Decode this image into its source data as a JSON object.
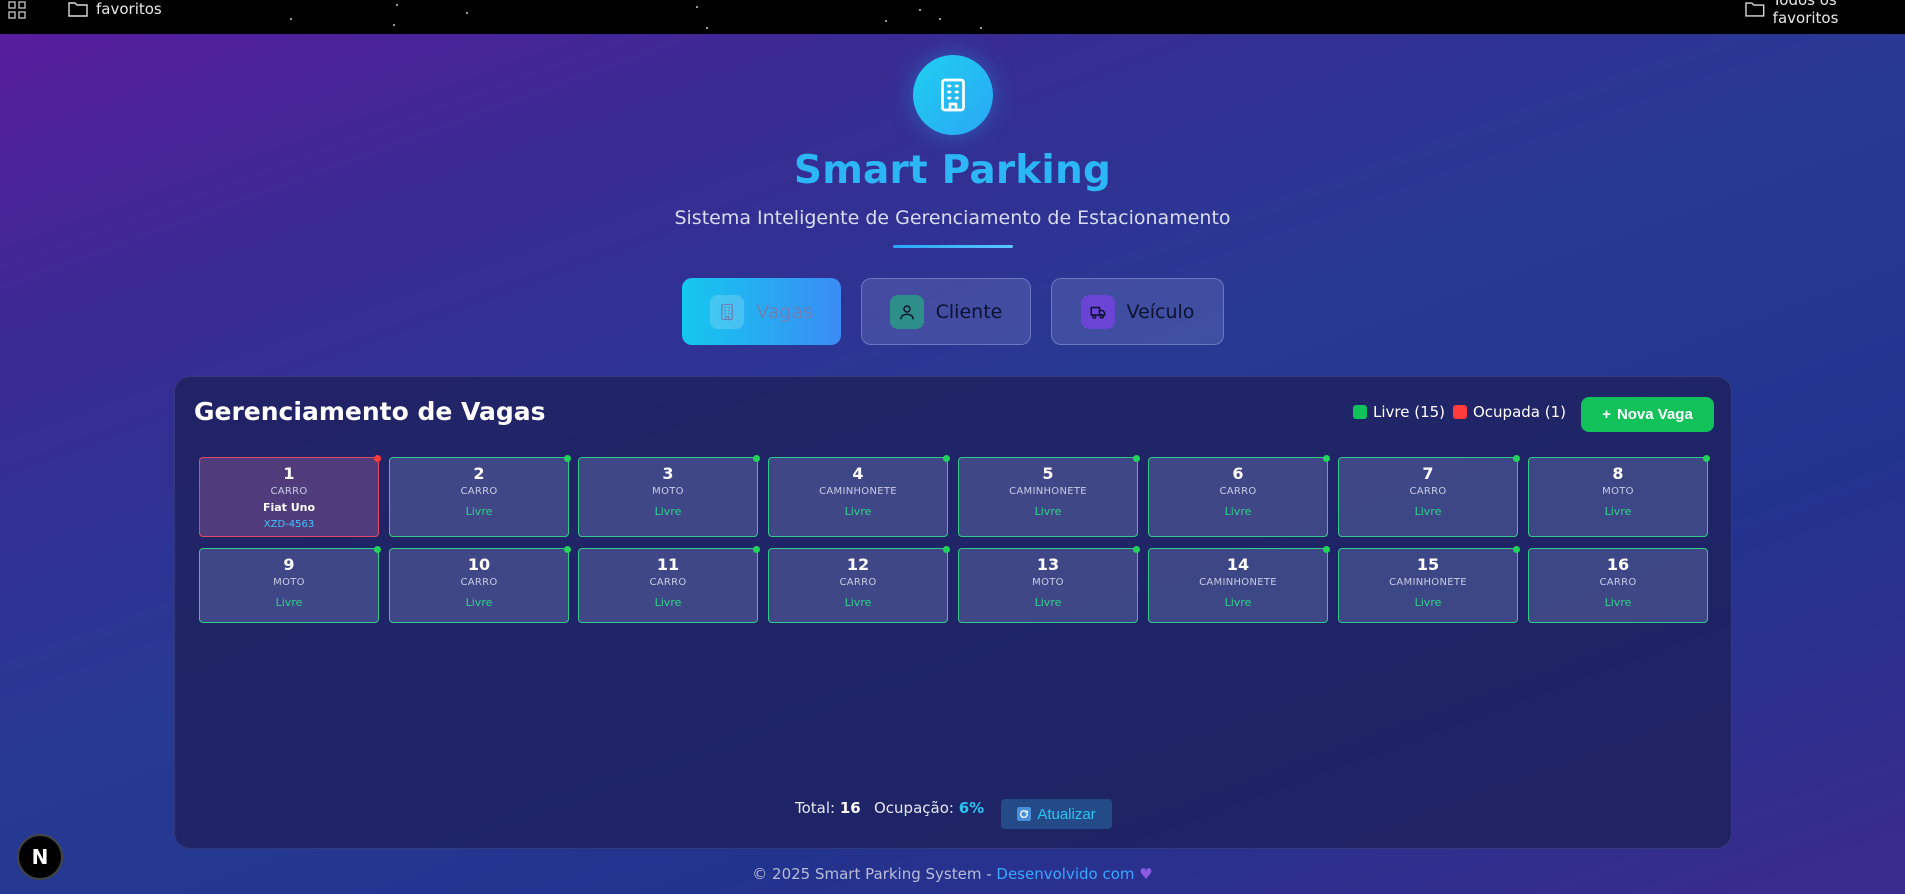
{
  "bookmarks": {
    "left_label": "favoritos",
    "right_label": "Todos os favoritos"
  },
  "header": {
    "title": "Smart Parking",
    "subtitle": "Sistema Inteligente de Gerenciamento de Estacionamento"
  },
  "tabs": [
    {
      "label": "Vagas",
      "icon": "building-icon",
      "active": true
    },
    {
      "label": "Cliente",
      "icon": "user-icon",
      "active": false
    },
    {
      "label": "Veículo",
      "icon": "truck-icon",
      "active": false
    }
  ],
  "panel": {
    "title": "Gerenciamento de Vagas",
    "legend_free": "Livre (15)",
    "legend_occupied": "Ocupada (1)",
    "new_button": "Nova Vaga",
    "colors": {
      "free": "#22d35b",
      "occupied": "#ff3b3b",
      "accent": "#11c25a"
    }
  },
  "spots": [
    {
      "number": "1",
      "type": "CARRO",
      "model": "Fiat Uno",
      "plate": "XZD-4563",
      "occupied": true
    },
    {
      "number": "2",
      "type": "CARRO",
      "status": "Livre",
      "occupied": false
    },
    {
      "number": "3",
      "type": "MOTO",
      "status": "Livre",
      "occupied": false
    },
    {
      "number": "4",
      "type": "CAMINHONETE",
      "status": "Livre",
      "occupied": false
    },
    {
      "number": "5",
      "type": "CAMINHONETE",
      "status": "Livre",
      "occupied": false
    },
    {
      "number": "6",
      "type": "CARRO",
      "status": "Livre",
      "occupied": false
    },
    {
      "number": "7",
      "type": "CARRO",
      "status": "Livre",
      "occupied": false
    },
    {
      "number": "8",
      "type": "MOTO",
      "status": "Livre",
      "occupied": false
    },
    {
      "number": "9",
      "type": "MOTO",
      "status": "Livre",
      "occupied": false
    },
    {
      "number": "10",
      "type": "CARRO",
      "status": "Livre",
      "occupied": false
    },
    {
      "number": "11",
      "type": "CARRO",
      "status": "Livre",
      "occupied": false
    },
    {
      "number": "12",
      "type": "CARRO",
      "status": "Livre",
      "occupied": false
    },
    {
      "number": "13",
      "type": "MOTO",
      "status": "Livre",
      "occupied": false
    },
    {
      "number": "14",
      "type": "CAMINHONETE",
      "status": "Livre",
      "occupied": false
    },
    {
      "number": "15",
      "type": "CAMINHONETE",
      "status": "Livre",
      "occupied": false
    },
    {
      "number": "16",
      "type": "CARRO",
      "status": "Livre",
      "occupied": false
    }
  ],
  "stats": {
    "total_label": "Total:",
    "total_value": "16",
    "occupancy_label": "Ocupação:",
    "occupancy_value": "6%",
    "refresh_button": "Atualizar"
  },
  "footer": {
    "text": "© 2025 Smart Parking System - ",
    "link": "Desenvolvido com"
  },
  "badge": {
    "letter": "N"
  }
}
